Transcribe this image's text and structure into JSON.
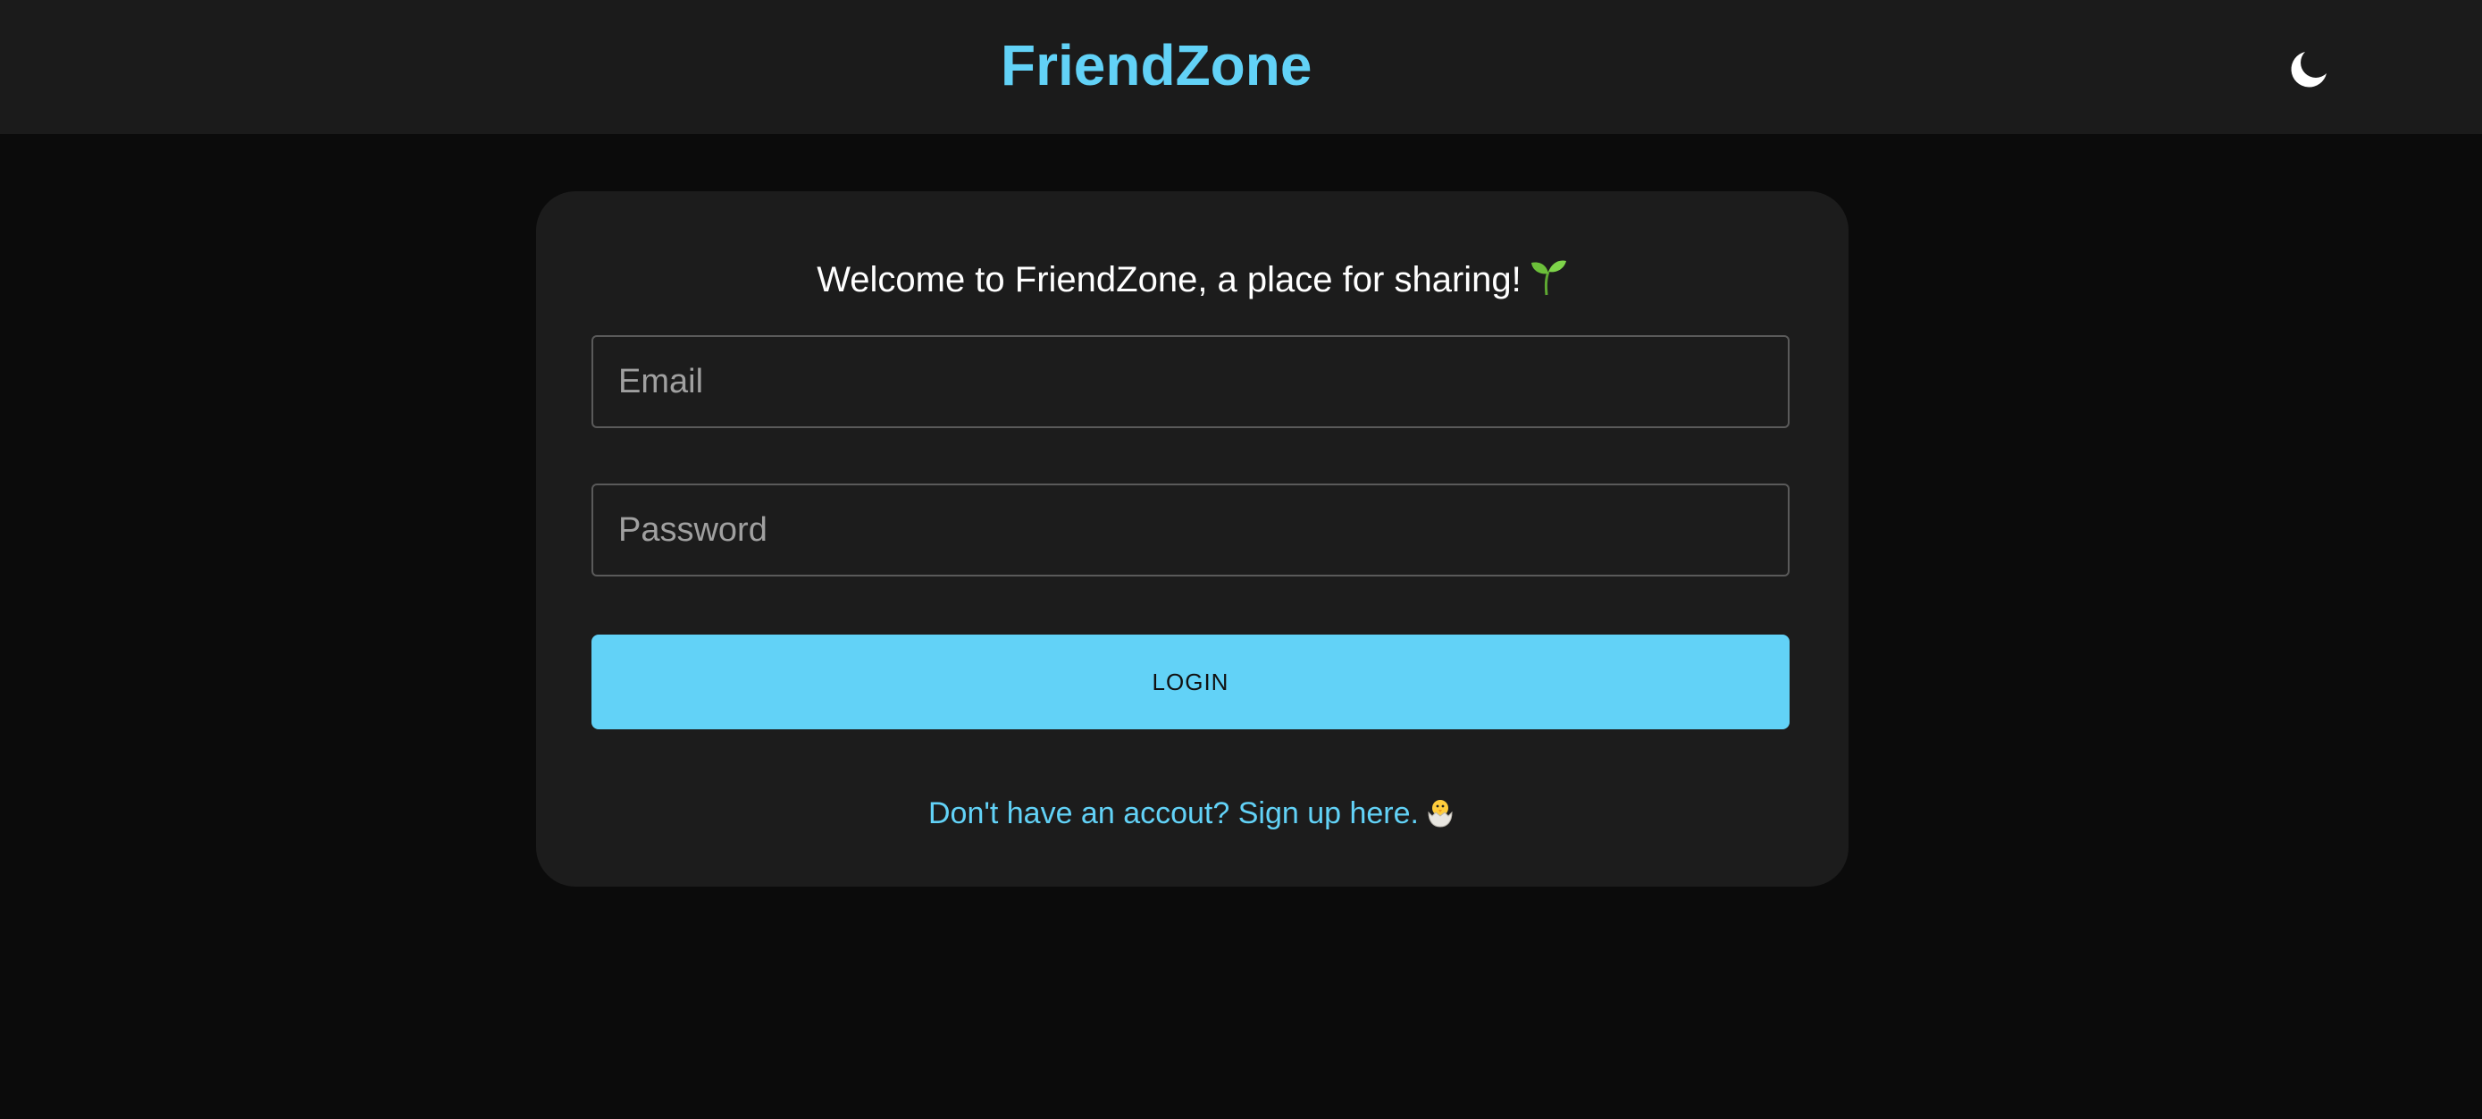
{
  "header": {
    "brand": "FriendZone",
    "theme_toggle_icon": "moon-icon"
  },
  "login_card": {
    "welcome_text": "Welcome to FriendZone, a place for sharing!",
    "welcome_icon": "sprout-icon",
    "email_placeholder": "Email",
    "email_value": "",
    "password_placeholder": "Password",
    "password_value": "",
    "login_label": "LOGIN",
    "signup_text": "Don't have an accout? Sign up here.",
    "signup_icon": "hatching-chick-icon"
  },
  "colors": {
    "accent": "#62d2f7",
    "page_background": "#0b0b0b",
    "header_background": "#1b1b1b",
    "card_background": "#1c1c1c"
  }
}
